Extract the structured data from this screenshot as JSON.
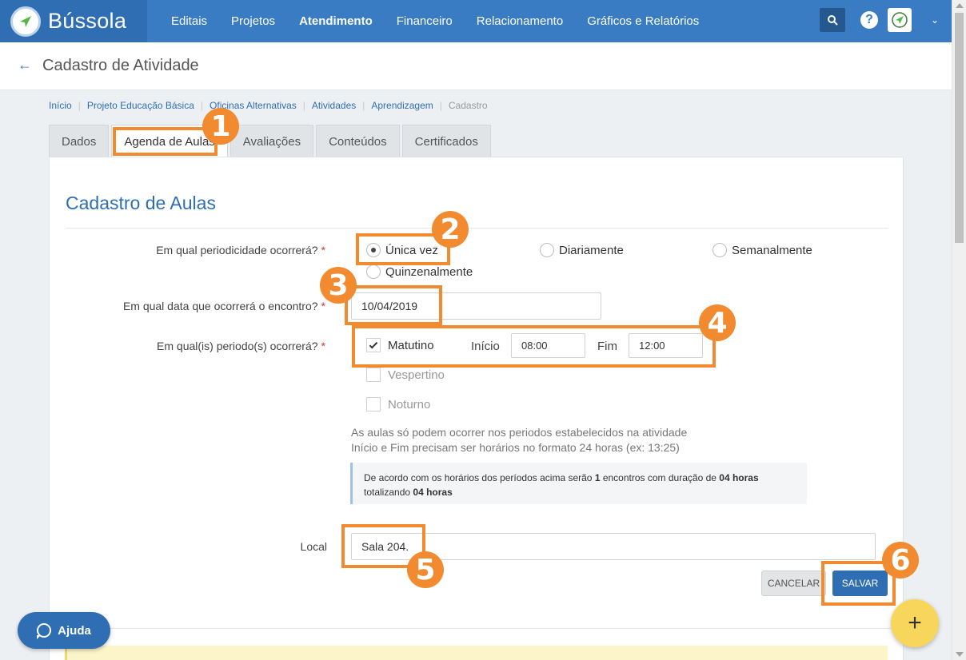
{
  "app": {
    "name": "Bússola",
    "colors": {
      "primary": "#3a7cc4",
      "dark": "#2f6eb3",
      "accent": "#f28a2f",
      "fab": "#f8d65b"
    }
  },
  "nav": {
    "items": [
      "Editais",
      "Projetos",
      "Atendimento",
      "Financeiro",
      "Relacionamento",
      "Gráficos e Relatórios"
    ],
    "active": "Atendimento"
  },
  "header": {
    "title": "Cadastro de Atividade"
  },
  "breadcrumb": [
    "Início",
    "Projeto Educação Básica",
    "Oficinas Alternativas",
    "Atividades",
    "Aprendizagem"
  ],
  "breadcrumb_current": "Cadastro",
  "tabs": [
    "Dados",
    "Agenda de Aulas",
    "Avaliações",
    "Conteúdos",
    "Certificados"
  ],
  "active_tab": "Agenda de Aulas",
  "form": {
    "title": "Cadastro de Aulas",
    "periodicity": {
      "label": "Em qual periodicidade ocorrerá?",
      "options": [
        "Única vez",
        "Diariamente",
        "Semanalmente",
        "Quinzenalmente"
      ],
      "selected": "Única vez"
    },
    "date": {
      "label": "Em qual data que ocorrerá o encontro?",
      "value": "10/04/2019"
    },
    "periods": {
      "label": "Em qual(is) periodo(s) ocorrerá?",
      "morning": "Matutino",
      "afternoon": "Vespertino",
      "night": "Noturno",
      "start_label": "Início",
      "start_value": "08:00",
      "end_label": "Fim",
      "end_value": "12:00"
    },
    "help_line1": "As aulas só podem ocorrer nos periodos estabelecidos na atividade",
    "help_line2": "Início e Fim precisam ser horários no formato 24 horas (ex: 13:25)",
    "info": {
      "part1": "De acordo com os horários dos períodos acima serão ",
      "count": "1",
      "part2": " encontros com duração de ",
      "duration": "04 horas",
      "part3": "totalizando ",
      "total": "04 horas"
    },
    "local": {
      "label": "Local",
      "value": "Sala 204."
    },
    "cancel": "CANCELAR",
    "save": "SALVAR",
    "required_mark": "*"
  },
  "help_button": "Ajuda",
  "add_button": "+",
  "annotations": [
    "1",
    "2",
    "3",
    "4",
    "5",
    "6"
  ]
}
